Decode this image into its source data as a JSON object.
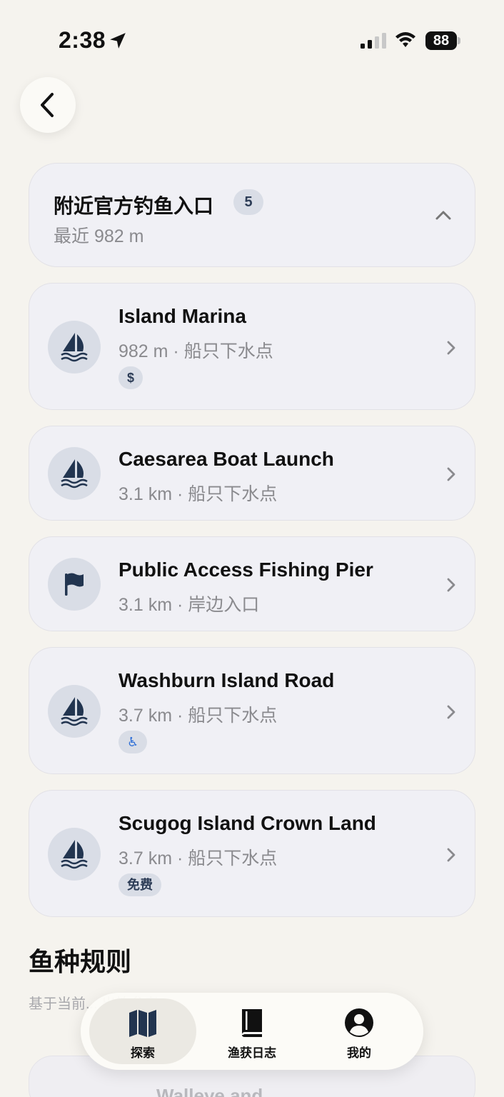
{
  "status": {
    "time": "2:38",
    "battery": "88"
  },
  "header": {
    "title": "附近官方钓鱼入口",
    "count": "5",
    "subtitle": "最近 982 m"
  },
  "items": [
    {
      "title": "Island Marina",
      "subtitle": "982 m · 船只下水点",
      "icon": "sailboat-icon",
      "tag": "$"
    },
    {
      "title": "Caesarea Boat Launch",
      "subtitle": "3.1 km · 船只下水点",
      "icon": "sailboat-icon"
    },
    {
      "title": "Public Access Fishing Pier",
      "subtitle": "3.1 km · 岸边入口",
      "icon": "flag-icon"
    },
    {
      "title": "Washburn Island Road",
      "subtitle": "3.7 km · 船只下水点",
      "icon": "sailboat-icon",
      "tag": "♿"
    },
    {
      "title": "Scugog Island Crown Land",
      "subtitle": "3.7 km · 船只下水点",
      "icon": "sailboat-icon",
      "tag": "免费"
    }
  ],
  "section": {
    "title": "鱼种规则",
    "description": "基于当前... 出钓参考。",
    "peek_title": "Walleye and"
  },
  "tabs": [
    {
      "label": "探索",
      "icon": "map-icon",
      "active": true
    },
    {
      "label": "渔获日志",
      "icon": "book-icon",
      "active": false
    },
    {
      "label": "我的",
      "icon": "person-icon",
      "active": false
    }
  ],
  "colors": {
    "background": "#f5f3ee",
    "card": "#f0f0f5",
    "icon_circle": "#d9dde6",
    "icon_fill": "#223550"
  }
}
